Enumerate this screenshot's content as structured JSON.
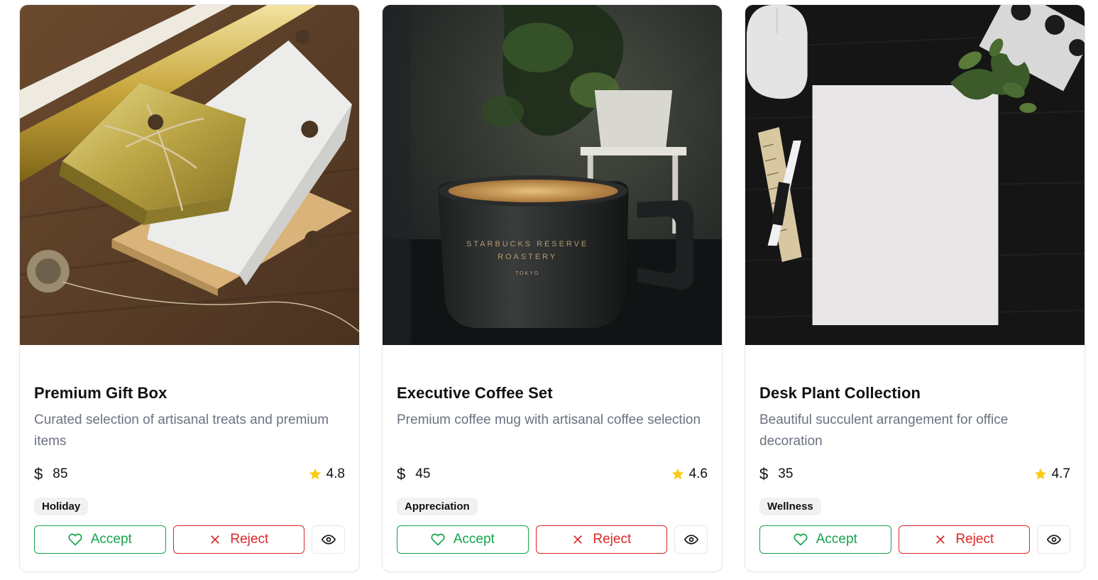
{
  "colors": {
    "accept": "#16a34a",
    "reject": "#dc2626",
    "star": "#facc15",
    "muted_text": "#6b7280",
    "tag_bg": "#f1f1f4"
  },
  "buttons": {
    "accept_label": "Accept",
    "reject_label": "Reject"
  },
  "icons": {
    "accept": "heart-icon",
    "reject": "x-icon",
    "view": "eye-icon",
    "price": "dollar-sign-icon",
    "rating": "star-icon"
  },
  "products": [
    {
      "title": "Premium Gift Box",
      "description": "Curated selection of artisanal treats and premium items",
      "price": "85",
      "rating": "4.8",
      "tag": "Holiday",
      "image": "gift-box-photo"
    },
    {
      "title": "Executive Coffee Set",
      "description": "Premium coffee mug with artisanal coffee selection",
      "price": "45",
      "rating": "4.6",
      "tag": "Appreciation",
      "image": "coffee-mug-photo",
      "image_text": [
        "STARBUCKS RESERVE",
        "ROASTERY",
        "TOKYO"
      ]
    },
    {
      "title": "Desk Plant Collection",
      "description": "Beautiful succulent arrangement for office decoration",
      "price": "35",
      "rating": "4.7",
      "tag": "Wellness",
      "image": "desk-flatlay-photo"
    }
  ]
}
